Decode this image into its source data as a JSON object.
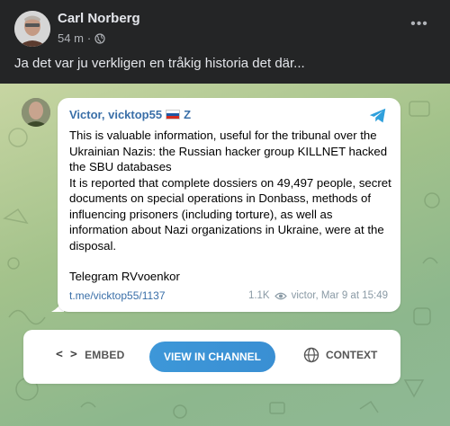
{
  "post": {
    "author": "Carl Norberg",
    "time": "54 m",
    "separator": "·",
    "text": "Ja det var ju verkligen en tråkig historia det där...",
    "more_label": "•••"
  },
  "telegram": {
    "channel_name": "Victor, vicktop55",
    "channel_suffix": "Z",
    "message_paragraphs": [
      "This is valuable information, useful for the tribunal over the Ukrainian Nazis: the Russian hacker group KILLNET hacked the SBU databases\nIt is reported that complete dossiers on 49,497 people, secret documents on special operations in Donbass, methods of influencing prisoners (including torture), as well as information about Nazi organizations in Ukraine, were at the disposal.",
      "Telegram RVvoenkor"
    ],
    "link": "t.me/vicktop55/1137",
    "views": "1.1K",
    "footer": "victor, Mar 9 at 15:49"
  },
  "actions": {
    "embed_label": "EMBED",
    "embed_code": "< >",
    "view_label": "VIEW IN CHANNEL",
    "context_label": "CONTEXT"
  },
  "colors": {
    "fb_background": "#242526",
    "link_blue": "#3a6fa8",
    "view_button": "#3d97d8",
    "telegram_blue": "#2fa0dc"
  },
  "icons": [
    "globe-icon",
    "more-icon",
    "telegram-logo-icon",
    "russia-flag-icon",
    "eye-icon",
    "code-icon",
    "globe-context-icon"
  ]
}
